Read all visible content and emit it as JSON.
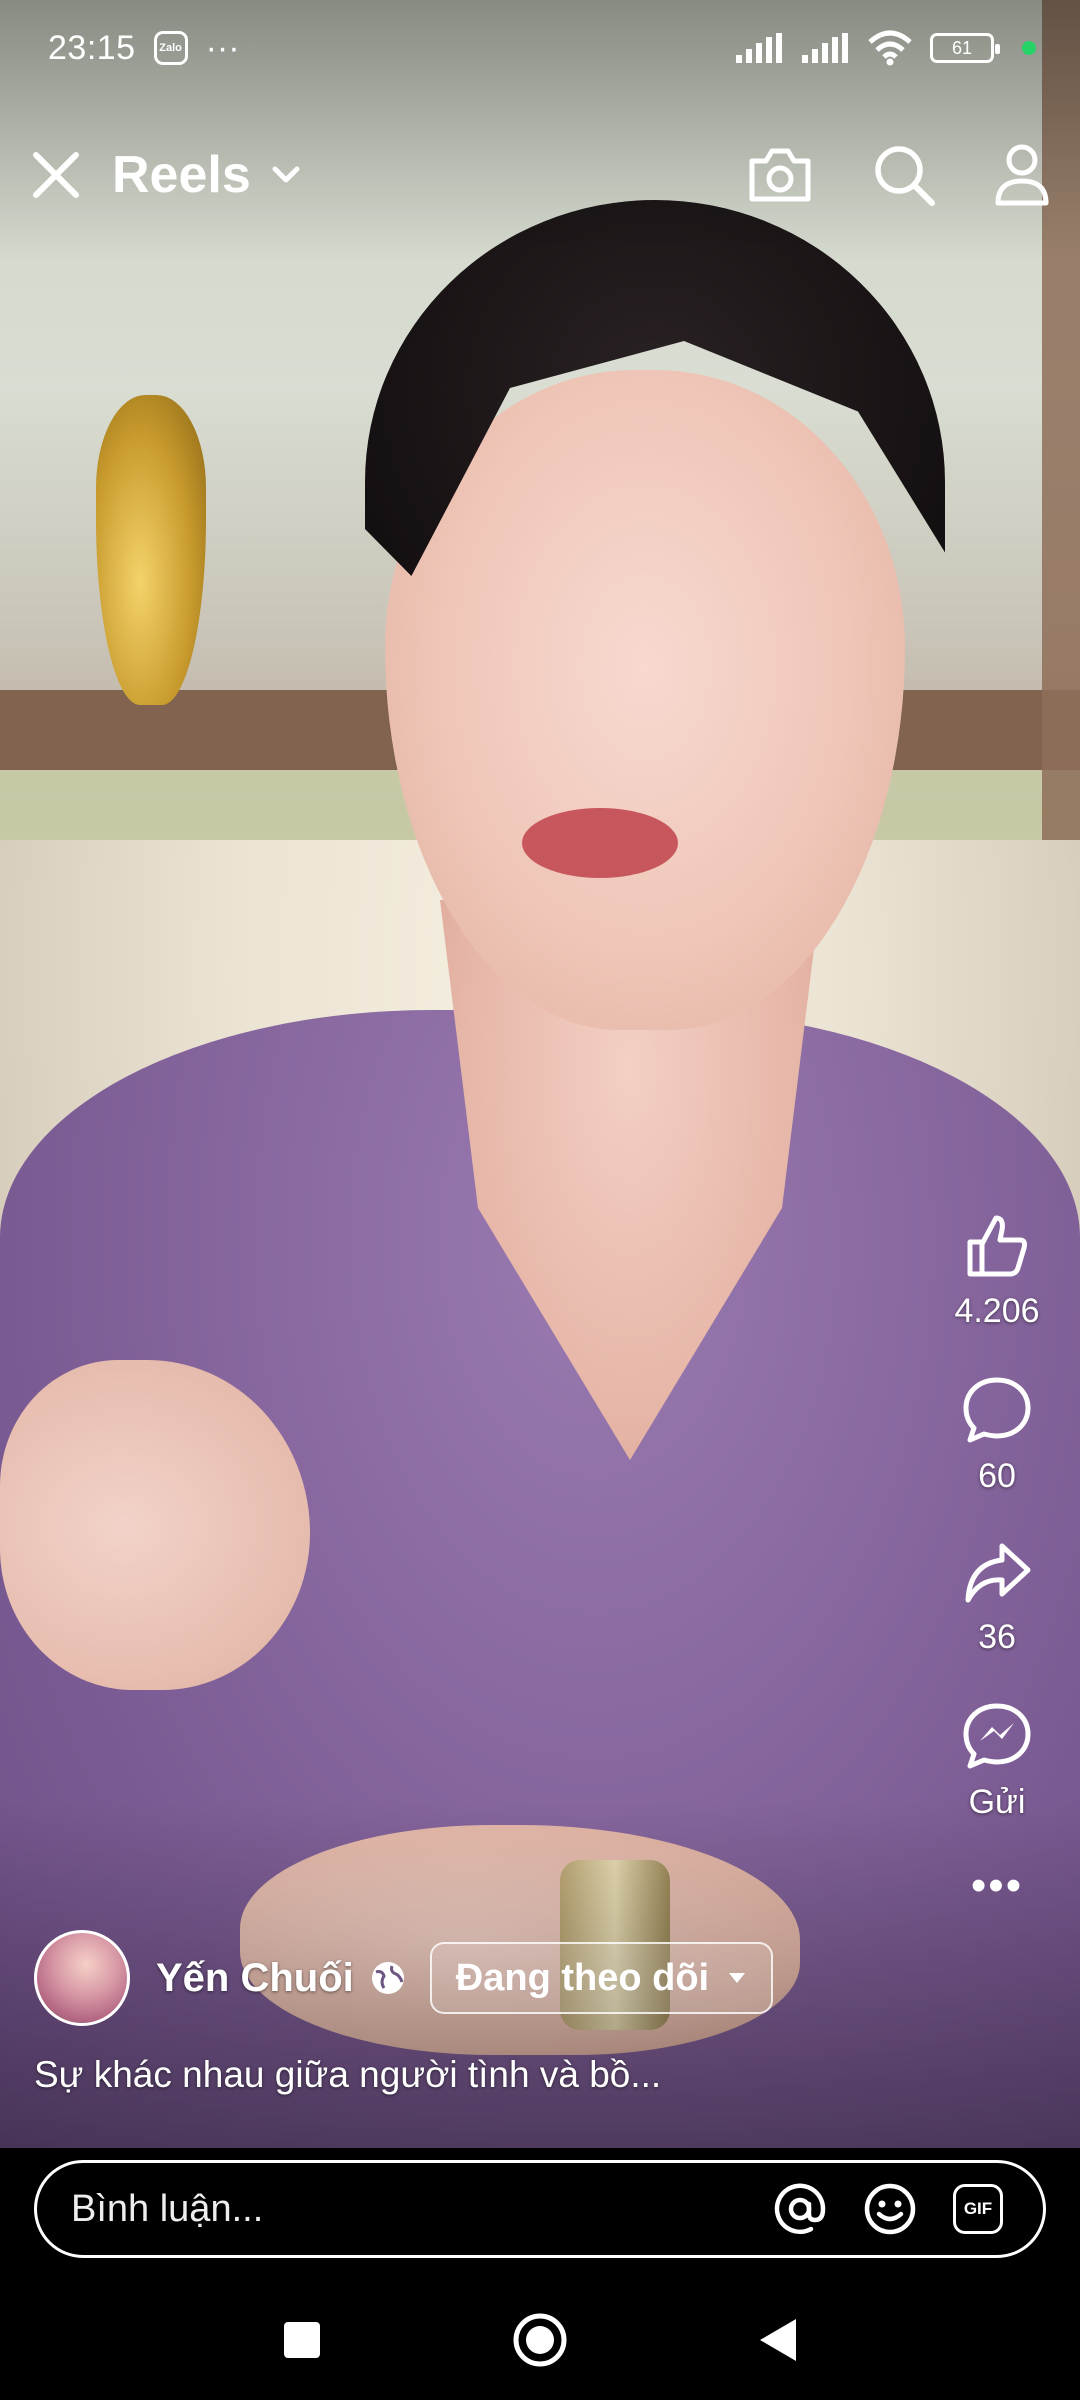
{
  "status_bar": {
    "time": "23:15",
    "notif_app_label": "Zalo",
    "overflow_dots": "···",
    "battery_level": "61"
  },
  "topnav": {
    "title": "Reels"
  },
  "actions": {
    "like_count": "4.206",
    "comment_count": "60",
    "share_count": "36",
    "send_label": "Gửi",
    "more_label": "•••"
  },
  "author": {
    "name": "Yến Chuối",
    "follow_label": "Đang theo dõi"
  },
  "caption": "Sự khác nhau giữa người tình và bồ...",
  "comment_bar": {
    "placeholder": "Bình luận...",
    "gif_label": "GIF"
  },
  "colors": {
    "online_dot": "#26d366",
    "shirt": "#8a6aa1"
  },
  "icons": [
    "close-icon",
    "chevron-down-icon",
    "camera-icon",
    "search-icon",
    "profile-icon",
    "like-icon",
    "comment-icon",
    "share-icon",
    "messenger-icon",
    "more-icon",
    "globe-icon",
    "caret-down-icon",
    "mention-icon",
    "emoji-icon",
    "gif-icon",
    "square-nav-icon",
    "home-nav-icon",
    "back-nav-icon"
  ]
}
